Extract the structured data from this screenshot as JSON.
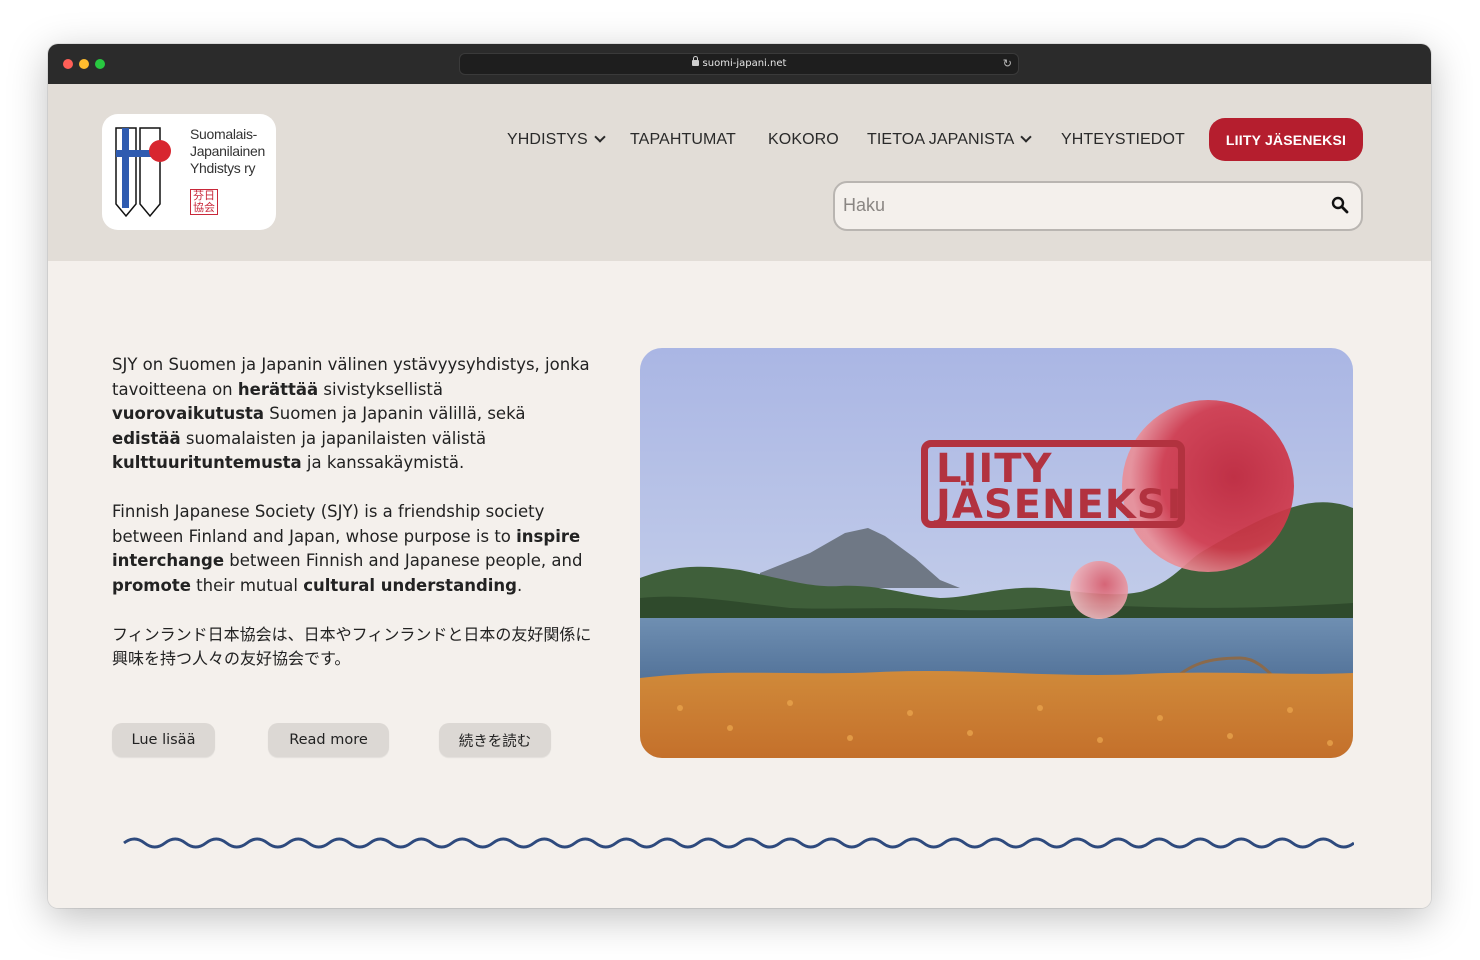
{
  "browser": {
    "url": "suomi-japani.net"
  },
  "logo": {
    "lines": [
      "Suomalais-",
      "Japanilainen",
      "Yhdistys ry"
    ],
    "stamp": "芬日\n協会"
  },
  "nav": {
    "items": [
      {
        "label": "YHDISTYS",
        "dropdown": true
      },
      {
        "label": "TAPAHTUMAT",
        "dropdown": false
      },
      {
        "label": "KOKORO",
        "dropdown": false
      },
      {
        "label": "TIETOA JAPANISTA",
        "dropdown": true
      },
      {
        "label": "YHTEYSTIEDOT",
        "dropdown": false
      }
    ],
    "join_button": "LIITY JÄSENEKSI"
  },
  "search": {
    "placeholder": "Haku"
  },
  "intro": {
    "fi": [
      {
        "t": "SJY on Suomen ja Japanin välinen ystävyysyhdistys, jonka tavoitteena on ",
        "b": false
      },
      {
        "t": "herättää",
        "b": true
      },
      {
        "t": " sivistyksellistä ",
        "b": false
      },
      {
        "t": "vuorovaikutusta",
        "b": true
      },
      {
        "t": " Suomen ja Japanin välillä, sekä ",
        "b": false
      },
      {
        "t": "edistää",
        "b": true
      },
      {
        "t": " suomalaisten ja japanilaisten välistä ",
        "b": false
      },
      {
        "t": "kulttuurituntemusta",
        "b": true
      },
      {
        "t": " ja kanssakäymistä.",
        "b": false
      }
    ],
    "en": [
      {
        "t": "Finnish Japanese Society (SJY) is a friendship society between Finland and Japan, whose purpose is to ",
        "b": false
      },
      {
        "t": "inspire interchange",
        "b": true
      },
      {
        "t": " between Finnish and Japanese people, and ",
        "b": false
      },
      {
        "t": "promote",
        "b": true
      },
      {
        "t": " their mutual ",
        "b": false
      },
      {
        "t": "cultural understanding",
        "b": true
      },
      {
        "t": ".",
        "b": false
      }
    ],
    "ja": "フィンランド日本協会は、日本やフィンランドと日本の友好関係に興味を持つ人々の友好協会です。"
  },
  "buttons": {
    "read_fi": "Lue lisää",
    "read_en": "Read more",
    "read_ja": "続きを読む"
  },
  "hero": {
    "badge_line1": "LIITY",
    "badge_line2": "JÄSENEKSI"
  },
  "colors": {
    "accent": "#b51e2e",
    "header_bg": "#e2ddd7",
    "page_bg": "#f4f0ec",
    "wave": "#2e4a7d"
  }
}
